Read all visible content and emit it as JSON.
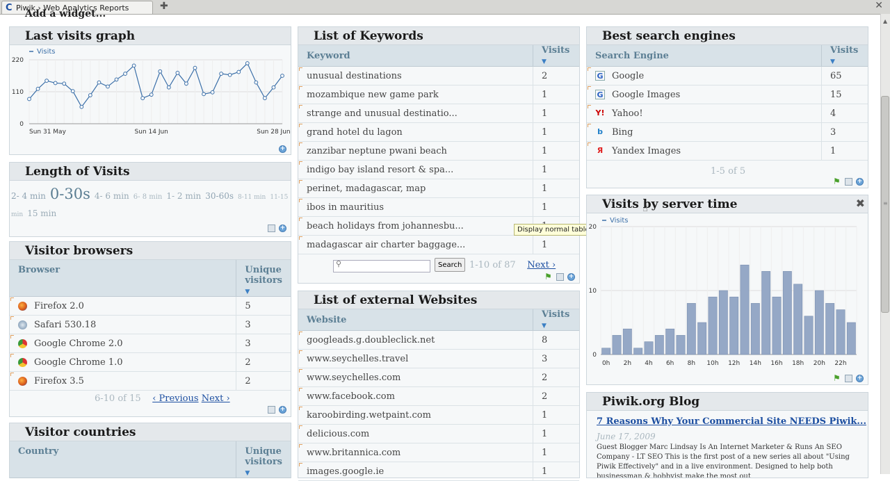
{
  "browser": {
    "tab_title": "Piwik › Web Analytics Reports"
  },
  "page": {
    "add_widget": "Add a widget..."
  },
  "last_visits": {
    "title": "Last visits graph",
    "chart_data": {
      "type": "line",
      "series": [
        {
          "name": "Visits",
          "values": [
            85,
            120,
            148,
            140,
            138,
            112,
            58,
            98,
            142,
            128,
            152,
            172,
            200,
            88,
            100,
            180,
            125,
            175,
            138,
            192,
            102,
            108,
            172,
            168,
            178,
            208,
            142,
            88,
            125,
            165
          ]
        }
      ],
      "x_tick_labels": [
        "Sun 31 May",
        "Sun 14 Jun",
        "Sun 28 Jun"
      ],
      "y_tick_labels": [
        "0",
        "110",
        "220"
      ],
      "ylim": [
        0,
        220
      ],
      "grid": true,
      "legend": "top-left"
    }
  },
  "length_of_visits": {
    "title": "Length of Visits",
    "tags": [
      {
        "label": "2- 4 min",
        "size": 12,
        "color": "#8fa3b2"
      },
      {
        "label": "0-30s",
        "size": 21,
        "color": "#5a7d92"
      },
      {
        "label": "4- 6 min",
        "size": 12,
        "color": "#9aabb6"
      },
      {
        "label": "6- 8 min",
        "size": 10,
        "color": "#a9b8c1"
      },
      {
        "label": "1- 2 min",
        "size": 12,
        "color": "#9aabb6"
      },
      {
        "label": "30-60s",
        "size": 12,
        "color": "#8fa3b2"
      },
      {
        "label": "8-11 min",
        "size": 9,
        "color": "#a9b8c1"
      },
      {
        "label": "11-15 min",
        "size": 9,
        "color": "#a9b8c1"
      },
      {
        "label": "15 min",
        "size": 12,
        "color": "#9aabb6"
      }
    ]
  },
  "visitor_browsers": {
    "title": "Visitor browsers",
    "col_browser": "Browser",
    "col_unique": "Unique visitors",
    "rows": [
      {
        "name": "Firefox 2.0",
        "value": "5",
        "icon": "firefox-icon"
      },
      {
        "name": "Safari 530.18",
        "value": "3",
        "icon": "safari-icon"
      },
      {
        "name": "Google Chrome 2.0",
        "value": "3",
        "icon": "chrome-icon"
      },
      {
        "name": "Google Chrome 1.0",
        "value": "2",
        "icon": "chrome-icon"
      },
      {
        "name": "Firefox 3.5",
        "value": "2",
        "icon": "firefox-icon"
      }
    ],
    "pager_range": "6-10 of 15",
    "prev": "‹ Previous",
    "next": "Next ›"
  },
  "visitor_countries": {
    "title": "Visitor countries",
    "col_country": "Country",
    "col_unique": "Unique visitors"
  },
  "keywords": {
    "title": "List of Keywords",
    "col_keyword": "Keyword",
    "col_visits": "Visits",
    "rows": [
      {
        "name": "unusual destinations",
        "value": "2"
      },
      {
        "name": "mozambique new game park",
        "value": "1"
      },
      {
        "name": "strange and unusual destinatio...",
        "value": "1"
      },
      {
        "name": "grand hotel du lagon",
        "value": "1"
      },
      {
        "name": "zanzibar neptune pwani beach",
        "value": "1"
      },
      {
        "name": "indigo bay island resort & spa...",
        "value": "1"
      },
      {
        "name": "perinet, madagascar, map",
        "value": "1"
      },
      {
        "name": "ibos in mauritius",
        "value": "1"
      },
      {
        "name": "beach holidays from johannesbu...",
        "value": "1"
      },
      {
        "name": "madagascar air charter baggage...",
        "value": "1"
      }
    ],
    "search_placeholder": "",
    "search_button": "Search",
    "pager_range": "1-10 of 87",
    "next": "Next ›",
    "tooltip": "Display normal table"
  },
  "external_websites": {
    "title": "List of external Websites",
    "col_website": "Website",
    "col_visits": "Visits",
    "rows": [
      {
        "name": "googleads.g.doubleclick.net",
        "value": "8"
      },
      {
        "name": "www.seychelles.travel",
        "value": "3"
      },
      {
        "name": "www.seychelles.com",
        "value": "2"
      },
      {
        "name": "www.facebook.com",
        "value": "2"
      },
      {
        "name": "karoobirding.wetpaint.com",
        "value": "1"
      },
      {
        "name": "delicious.com",
        "value": "1"
      },
      {
        "name": "www.britannica.com",
        "value": "1"
      },
      {
        "name": "images.google.ie",
        "value": "1"
      }
    ]
  },
  "search_engines": {
    "title": "Best search engines",
    "col_engine": "Search Engine",
    "col_visits": "Visits",
    "rows": [
      {
        "name": "Google",
        "value": "65",
        "icon": "google-icon",
        "glyph": "G",
        "color": "#2b62c4"
      },
      {
        "name": "Google Images",
        "value": "15",
        "icon": "google-icon",
        "glyph": "G",
        "color": "#2b62c4"
      },
      {
        "name": "Yahoo!",
        "value": "4",
        "icon": "yahoo-icon",
        "glyph": "Y!",
        "color": "#cc0000"
      },
      {
        "name": "Bing",
        "value": "3",
        "icon": "bing-icon",
        "glyph": "b",
        "color": "#1e7ec8"
      },
      {
        "name": "Yandex Images",
        "value": "1",
        "icon": "yandex-icon",
        "glyph": "Я",
        "color": "#e02020"
      }
    ],
    "pager_range": "1-5 of 5"
  },
  "server_time": {
    "title": "Visits by server time",
    "chart_data": {
      "type": "bar",
      "series": [
        {
          "name": "Visits",
          "values": [
            1,
            3,
            4,
            1,
            2,
            3,
            4,
            3,
            8,
            5,
            9,
            10,
            9,
            14,
            8,
            13,
            9,
            13,
            11,
            6,
            10,
            8,
            7,
            5
          ]
        }
      ],
      "categories": [
        "0h",
        "1h",
        "2h",
        "3h",
        "4h",
        "5h",
        "6h",
        "7h",
        "8h",
        "9h",
        "10h",
        "11h",
        "12h",
        "13h",
        "14h",
        "15h",
        "16h",
        "17h",
        "18h",
        "19h",
        "20h",
        "21h",
        "22h",
        "23h"
      ],
      "x_tick_labels": [
        "0h",
        "2h",
        "4h",
        "6h",
        "8h",
        "10h",
        "12h",
        "14h",
        "16h",
        "18h",
        "20h",
        "22h"
      ],
      "y_tick_labels": [
        "0",
        "10",
        "20"
      ],
      "ylim": [
        0,
        20
      ],
      "grid": true,
      "legend": "top-left"
    }
  },
  "blog": {
    "title": "Piwik.org Blog",
    "post_title": "7 Reasons Why Your Commercial Site NEEDS Piwik...",
    "post_date": "June 17, 2009",
    "post_text": "Guest Blogger Marc Lindsay Is An Internet Marketer & Runs An SEO Company - LT SEO This is the first post of a new series all about \"Using Piwik Effectively\" and in a live environment. Designed to help both businessman & hobbyist make the most out"
  },
  "colors": {
    "header_bg": "#e4e8eb",
    "table_header_bg": "#d8e2e8",
    "table_header_text": "#5c7f94",
    "link": "#1d4fa1",
    "bar": "#95a8c6",
    "line": "#3b6fa8"
  }
}
